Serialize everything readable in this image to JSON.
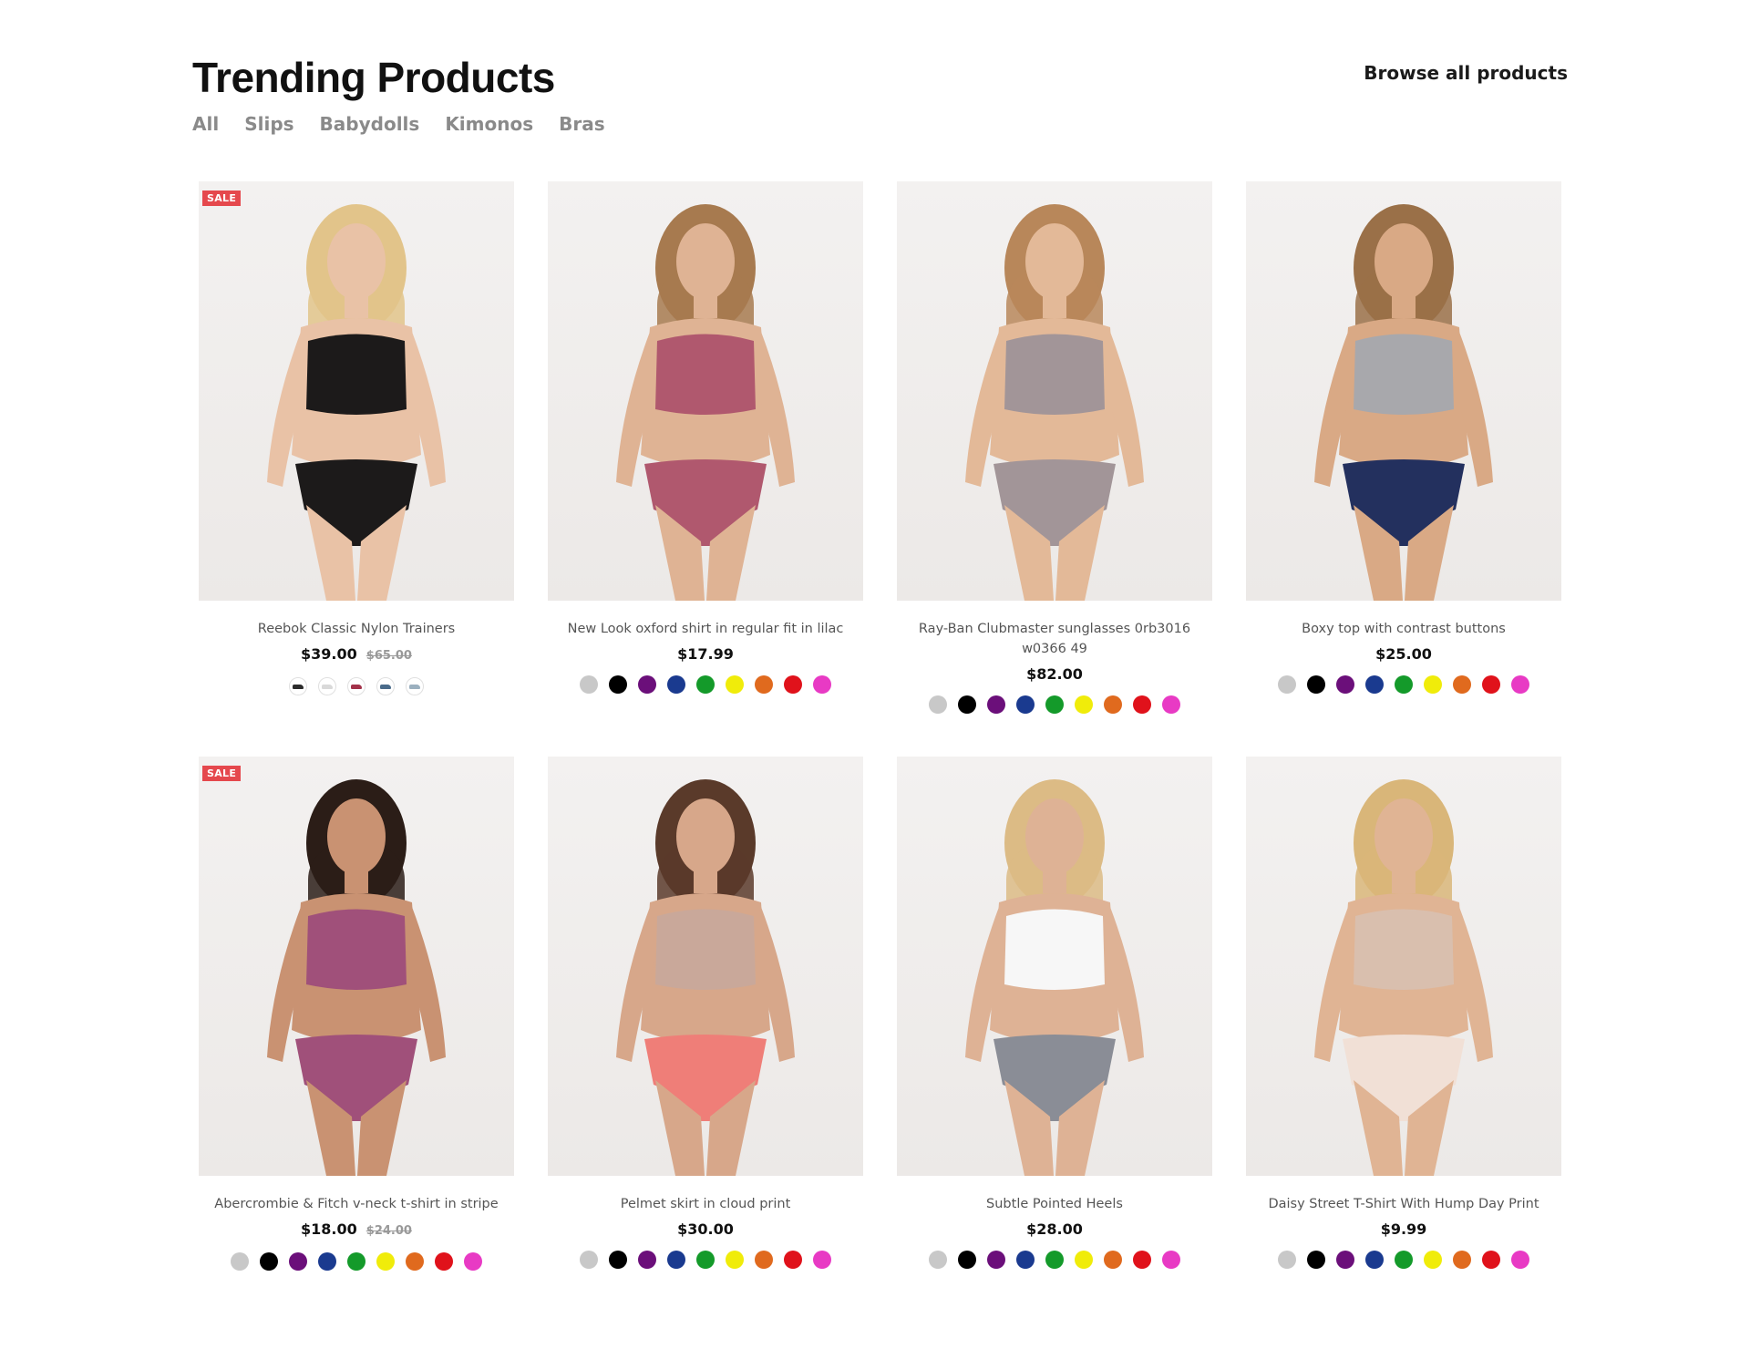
{
  "section": {
    "title": "Trending Products",
    "browse_label": "Browse all products",
    "filters": [
      "All",
      "Slips",
      "Babydolls",
      "Kimonos",
      "Bras"
    ]
  },
  "products": [
    {
      "name": "Reebok Classic Nylon Trainers",
      "price": "$39.00",
      "old_price": "$65.00",
      "badge": "SALE",
      "swatch_type": "image",
      "swatches": [
        "#2b2b2b",
        "#d9d9d9",
        "#a3324a",
        "#4a6b8a",
        "#9bb0bf"
      ],
      "image": {
        "top": "#1c1a1a",
        "bottom": "#1c1a1a",
        "hair": "#e2c48a",
        "skin": "#e9c2a6"
      }
    },
    {
      "name": "New Look oxford shirt in regular fit in lilac",
      "price": "$17.99",
      "old_price": "",
      "badge": "",
      "swatch_type": "color",
      "swatches": [
        "#c8c8c8",
        "#000000",
        "#6b0f7a",
        "#1a3a8f",
        "#149a2a",
        "#f0ec0a",
        "#e06a1e",
        "#e0121b",
        "#e83ac4"
      ],
      "image": {
        "top": "#b0586e",
        "bottom": "#b0586e",
        "hair": "#a77a4f",
        "skin": "#dfb394"
      }
    },
    {
      "name": "Ray-Ban Clubmaster sunglasses 0rb3016 w0366 49",
      "price": "$82.00",
      "old_price": "",
      "badge": "",
      "swatch_type": "color",
      "swatches": [
        "#c8c8c8",
        "#000000",
        "#6b0f7a",
        "#1a3a8f",
        "#149a2a",
        "#f0ec0a",
        "#e06a1e",
        "#e0121b",
        "#e83ac4"
      ],
      "image": {
        "top": "#a29598",
        "bottom": "#a29598",
        "hair": "#b8875a",
        "skin": "#e3b998"
      }
    },
    {
      "name": "Boxy top with contrast buttons",
      "price": "$25.00",
      "old_price": "",
      "badge": "",
      "swatch_type": "color",
      "swatches": [
        "#c8c8c8",
        "#000000",
        "#6b0f7a",
        "#1a3a8f",
        "#149a2a",
        "#f0ec0a",
        "#e06a1e",
        "#e0121b",
        "#e83ac4"
      ],
      "image": {
        "top": "#a8a8ac",
        "bottom": "#23305e",
        "hair": "#9a7048",
        "skin": "#d9a985"
      }
    },
    {
      "name": "Abercrombie & Fitch v-neck t-shirt in stripe",
      "price": "$18.00",
      "old_price": "$24.00",
      "badge": "SALE",
      "swatch_type": "color",
      "swatches": [
        "#c8c8c8",
        "#000000",
        "#6b0f7a",
        "#1a3a8f",
        "#149a2a",
        "#f0ec0a",
        "#e06a1e",
        "#e0121b",
        "#e83ac4"
      ],
      "image": {
        "top": "#a0507a",
        "bottom": "#a0507a",
        "hair": "#2b1d17",
        "skin": "#c99272"
      }
    },
    {
      "name": "Pelmet skirt in cloud print",
      "price": "$30.00",
      "old_price": "",
      "badge": "",
      "swatch_type": "color",
      "swatches": [
        "#c8c8c8",
        "#000000",
        "#6b0f7a",
        "#1a3a8f",
        "#149a2a",
        "#f0ec0a",
        "#e06a1e",
        "#e0121b",
        "#e83ac4"
      ],
      "image": {
        "top": "#c9a89a",
        "bottom": "#ef7e78",
        "hair": "#5a3a2a",
        "skin": "#d7a78a"
      }
    },
    {
      "name": "Subtle Pointed Heels",
      "price": "$28.00",
      "old_price": "",
      "badge": "",
      "swatch_type": "color",
      "swatches": [
        "#c8c8c8",
        "#000000",
        "#6b0f7a",
        "#1a3a8f",
        "#149a2a",
        "#f0ec0a",
        "#e06a1e",
        "#e0121b",
        "#e83ac4"
      ],
      "image": {
        "top": "#f7f7f7",
        "bottom": "#8a8d96",
        "hair": "#dcbb85",
        "skin": "#deb295"
      }
    },
    {
      "name": "Daisy Street T-Shirt With Hump Day Print",
      "price": "$9.99",
      "old_price": "",
      "badge": "",
      "swatch_type": "color",
      "swatches": [
        "#c8c8c8",
        "#000000",
        "#6b0f7a",
        "#1a3a8f",
        "#149a2a",
        "#f0ec0a",
        "#e06a1e",
        "#e0121b",
        "#e83ac4"
      ],
      "image": {
        "top": "#d9bfae",
        "bottom": "#f1e0d6",
        "hair": "#d9b679",
        "skin": "#e0b494"
      }
    }
  ]
}
